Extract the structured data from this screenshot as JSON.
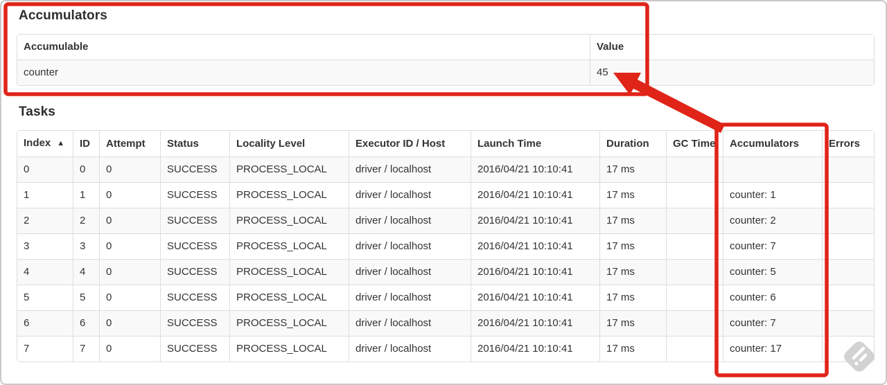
{
  "colors": {
    "annotation_red": "#e02418",
    "table_border": "#dddddd",
    "row_stripe": "#f9f9f9",
    "text": "#333333",
    "watermark_gray": "#d2d2d2"
  },
  "icons": {
    "sort_ascending": "sort-ascending-triangle",
    "watermark": "feedly-diamond-logo"
  },
  "accumulators": {
    "title": "Accumulators",
    "headers": [
      "Accumulable",
      "Value"
    ],
    "rows": [
      {
        "accumulable": "counter",
        "value": "45"
      }
    ]
  },
  "tasks": {
    "title": "Tasks",
    "sort_indicator": "▲",
    "headers": [
      "Index",
      "ID",
      "Attempt",
      "Status",
      "Locality Level",
      "Executor ID / Host",
      "Launch Time",
      "Duration",
      "GC Time",
      "Accumulators",
      "Errors"
    ],
    "rows": [
      {
        "index": "0",
        "id": "0",
        "attempt": "0",
        "status": "SUCCESS",
        "locality_level": "PROCESS_LOCAL",
        "executor_id_host": "driver / localhost",
        "launch_time": "2016/04/21 10:10:41",
        "duration": "17 ms",
        "gc_time": "",
        "accumulators": "",
        "errors": ""
      },
      {
        "index": "1",
        "id": "1",
        "attempt": "0",
        "status": "SUCCESS",
        "locality_level": "PROCESS_LOCAL",
        "executor_id_host": "driver / localhost",
        "launch_time": "2016/04/21 10:10:41",
        "duration": "17 ms",
        "gc_time": "",
        "accumulators": "counter: 1",
        "errors": ""
      },
      {
        "index": "2",
        "id": "2",
        "attempt": "0",
        "status": "SUCCESS",
        "locality_level": "PROCESS_LOCAL",
        "executor_id_host": "driver / localhost",
        "launch_time": "2016/04/21 10:10:41",
        "duration": "17 ms",
        "gc_time": "",
        "accumulators": "counter: 2",
        "errors": ""
      },
      {
        "index": "3",
        "id": "3",
        "attempt": "0",
        "status": "SUCCESS",
        "locality_level": "PROCESS_LOCAL",
        "executor_id_host": "driver / localhost",
        "launch_time": "2016/04/21 10:10:41",
        "duration": "17 ms",
        "gc_time": "",
        "accumulators": "counter: 7",
        "errors": ""
      },
      {
        "index": "4",
        "id": "4",
        "attempt": "0",
        "status": "SUCCESS",
        "locality_level": "PROCESS_LOCAL",
        "executor_id_host": "driver / localhost",
        "launch_time": "2016/04/21 10:10:41",
        "duration": "17 ms",
        "gc_time": "",
        "accumulators": "counter: 5",
        "errors": ""
      },
      {
        "index": "5",
        "id": "5",
        "attempt": "0",
        "status": "SUCCESS",
        "locality_level": "PROCESS_LOCAL",
        "executor_id_host": "driver / localhost",
        "launch_time": "2016/04/21 10:10:41",
        "duration": "17 ms",
        "gc_time": "",
        "accumulators": "counter: 6",
        "errors": ""
      },
      {
        "index": "6",
        "id": "6",
        "attempt": "0",
        "status": "SUCCESS",
        "locality_level": "PROCESS_LOCAL",
        "executor_id_host": "driver / localhost",
        "launch_time": "2016/04/21 10:10:41",
        "duration": "17 ms",
        "gc_time": "",
        "accumulators": "counter: 7",
        "errors": ""
      },
      {
        "index": "7",
        "id": "7",
        "attempt": "0",
        "status": "SUCCESS",
        "locality_level": "PROCESS_LOCAL",
        "executor_id_host": "driver / localhost",
        "launch_time": "2016/04/21 10:10:41",
        "duration": "17 ms",
        "gc_time": "",
        "accumulators": "counter: 17",
        "errors": ""
      }
    ]
  }
}
